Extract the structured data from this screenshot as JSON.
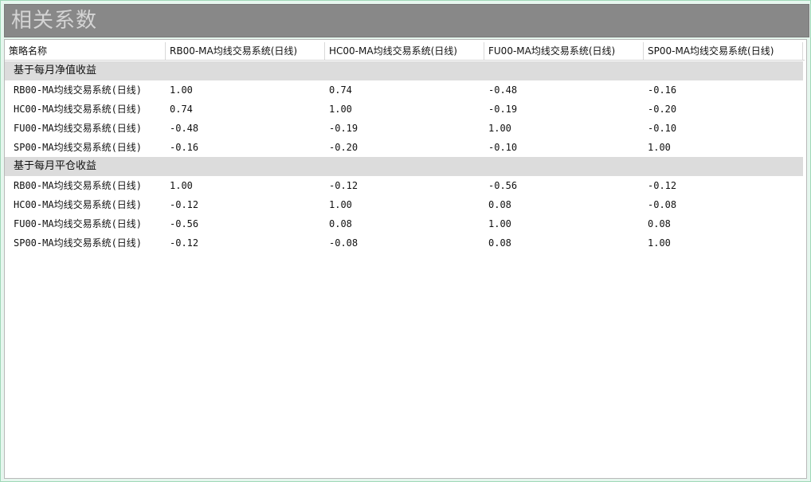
{
  "window": {
    "title": "相关系数"
  },
  "table": {
    "columns": [
      "策略名称",
      "RB00-MA均线交易系统(日线)",
      "HC00-MA均线交易系统(日线)",
      "FU00-MA均线交易系统(日线)",
      "SP00-MA均线交易系统(日线)"
    ],
    "groups": [
      {
        "label": "基于每月净值收益",
        "rows": [
          [
            "RB00-MA均线交易系统(日线)",
            "1.00",
            "0.74",
            "-0.48",
            "-0.16"
          ],
          [
            "HC00-MA均线交易系统(日线)",
            "0.74",
            "1.00",
            "-0.19",
            "-0.20"
          ],
          [
            "FU00-MA均线交易系统(日线)",
            "-0.48",
            "-0.19",
            "1.00",
            "-0.10"
          ],
          [
            "SP00-MA均线交易系统(日线)",
            "-0.16",
            "-0.20",
            "-0.10",
            "1.00"
          ]
        ]
      },
      {
        "label": "基于每月平仓收益",
        "rows": [
          [
            "RB00-MA均线交易系统(日线)",
            "1.00",
            "-0.12",
            "-0.56",
            "-0.12"
          ],
          [
            "HC00-MA均线交易系统(日线)",
            "-0.12",
            "1.00",
            "0.08",
            "-0.08"
          ],
          [
            "FU00-MA均线交易系统(日线)",
            "-0.56",
            "0.08",
            "1.00",
            "0.08"
          ],
          [
            "SP00-MA均线交易系统(日线)",
            "-0.12",
            "-0.08",
            "0.08",
            "1.00"
          ]
        ]
      }
    ]
  }
}
